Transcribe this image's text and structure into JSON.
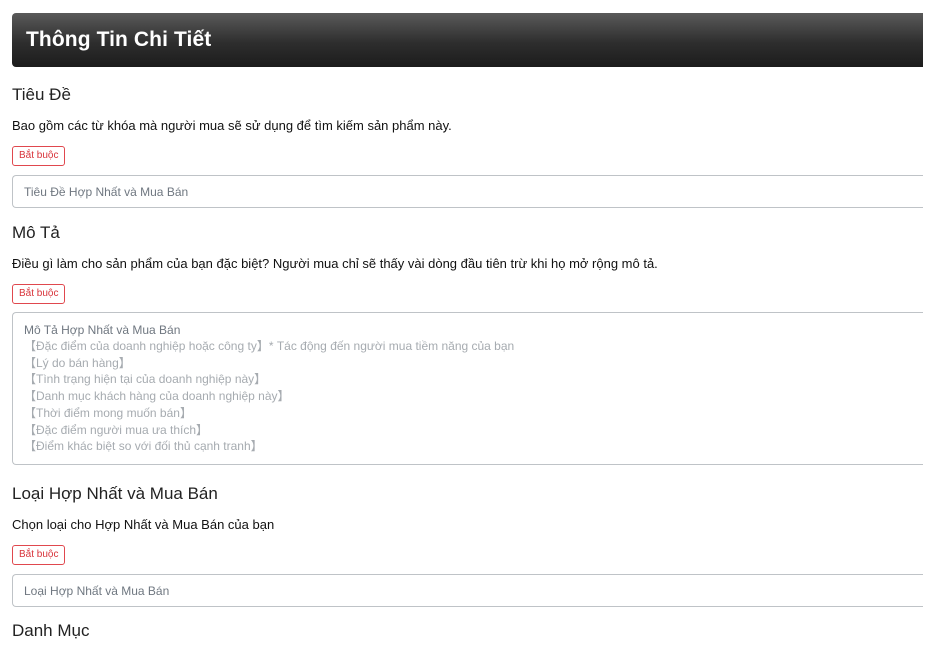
{
  "header": {
    "title": "Thông Tin Chi Tiết"
  },
  "title_section": {
    "title": "Tiêu Đề",
    "description": "Bao gồm các từ khóa mà người mua sẽ sử dụng để tìm kiếm sản phẩm này.",
    "required_label": "Bắt buộc",
    "input_placeholder": "Tiêu Đề Hợp Nhất và Mua Bán"
  },
  "description_section": {
    "title": "Mô Tả",
    "description": "Điều gì làm cho sản phẩm của bạn đặc biệt? Người mua chỉ sẽ thấy vài dòng đầu tiên trừ khi họ mở rộng mô tả.",
    "required_label": "Bắt buộc",
    "textarea_placeholder_first": "Mô Tả Hợp Nhất và Mua Bán",
    "textarea_placeholder_lines": [
      "【Đặc điểm của doanh nghiệp hoặc công ty】* Tác động đến người mua tiềm năng của bạn",
      "【Lý do bán hàng】",
      "【Tình trạng hiện tại của doanh nghiệp này】",
      "【Danh mục khách hàng của doanh nghiệp này】",
      "【Thời điểm mong muốn bán】",
      "【Đặc điểm người mua ưa thích】",
      "【Điểm khác biệt so với đối thủ cạnh tranh】"
    ]
  },
  "type_section": {
    "title": "Loại Hợp Nhất và Mua Bán",
    "description": "Chọn loại cho Hợp Nhất và Mua Bán của bạn",
    "required_label": "Bắt buộc",
    "input_placeholder": "Loại Hợp Nhất và Mua Bán"
  },
  "category_section": {
    "title": "Danh Mục"
  }
}
